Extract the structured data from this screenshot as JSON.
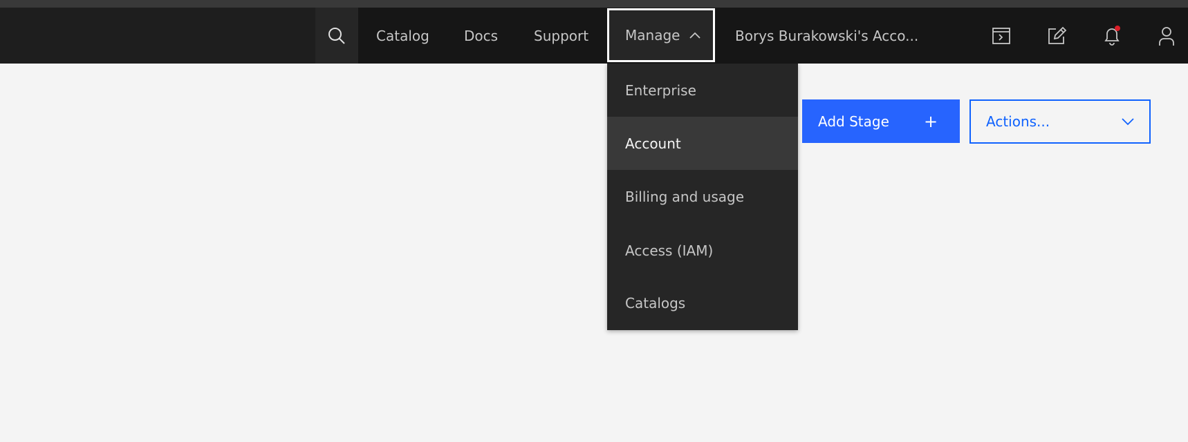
{
  "header": {
    "nav": {
      "catalog": "Catalog",
      "docs": "Docs",
      "support": "Support",
      "manage": "Manage",
      "account": "Borys Burakowski's Acco..."
    },
    "icons": [
      "search-icon",
      "chevron-up-icon",
      "terminal-icon",
      "edit-icon",
      "notification-icon",
      "user-icon"
    ],
    "notification_dot_color": "#da1e28"
  },
  "manage_menu": {
    "items": [
      {
        "label": "Enterprise"
      },
      {
        "label": "Account"
      },
      {
        "label": "Billing and usage"
      },
      {
        "label": "Access (IAM)"
      },
      {
        "label": "Catalogs"
      }
    ],
    "active_index": 1
  },
  "toolbar": {
    "add_stage_label": "Add Stage",
    "add_stage_icon": "+",
    "actions_label": "Actions..."
  },
  "colors": {
    "primary_button": "#2764fe",
    "header_bg": "#161616",
    "menu_bg": "#262626",
    "page_bg": "#f4f4f4"
  }
}
